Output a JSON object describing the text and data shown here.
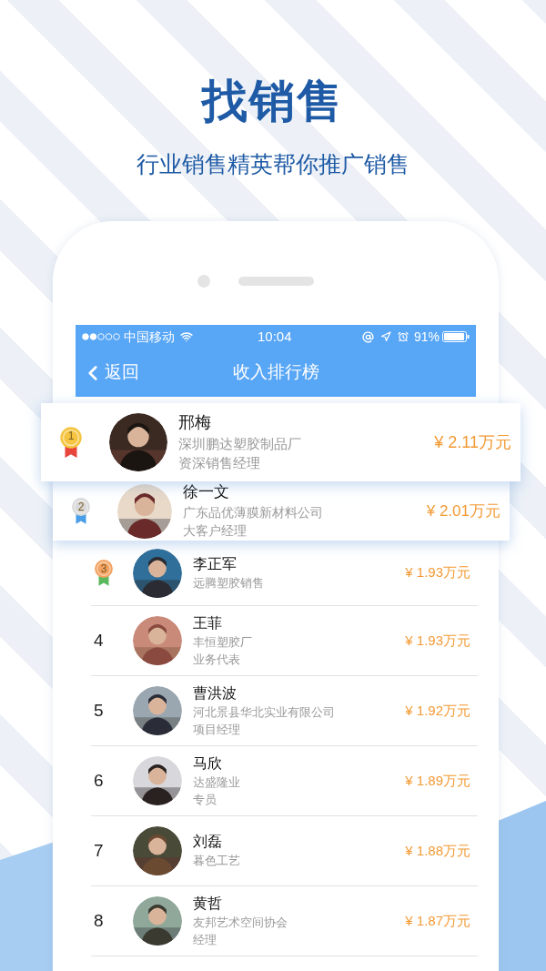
{
  "headline": "找销售",
  "subtitle": "行业销售精英帮你推广销售",
  "status_bar": {
    "carrier": "中国移动",
    "time": "10:04",
    "battery": "91%"
  },
  "nav_bar": {
    "back": "返回",
    "title": "收入排行榜"
  },
  "rows": [
    {
      "kind": "large",
      "medal": {
        "color": "#f5c542",
        "ribbon": {
          "color": "#e8453c"
        }
      },
      "rank": "1",
      "name": "邢梅",
      "company": "深圳鹏达塑胶制品厂",
      "title": "资深销售经理",
      "amount": "¥ 2.11万元"
    },
    {
      "kind": "medium",
      "medal": {
        "color": "#d9d9d9",
        "ribbon": {
          "color": "#4a9ee8"
        }
      },
      "rank": "2",
      "name": "徐一文",
      "company": "广东品优薄膜新材料公司",
      "title": "大客户经理",
      "amount": "¥ 2.01万元"
    },
    {
      "kind": "plain",
      "medal": {
        "color": "#f4a261",
        "ribbon": {
          "color": "#5cb85c"
        }
      },
      "rank": "3",
      "name": "李正军",
      "company": "远腾塑胶销售",
      "amount": "¥ 1.93万元"
    },
    {
      "kind": "plain",
      "rank": "4",
      "name": "王菲",
      "company": "丰恒塑胶厂",
      "title": "业务代表",
      "amount": "¥ 1.93万元"
    },
    {
      "kind": "plain",
      "rank": "5",
      "name": "曹洪波",
      "company": "河北景县华北实业有限公司",
      "title": "项目经理",
      "amount": "¥ 1.92万元"
    },
    {
      "kind": "plain",
      "rank": "6",
      "name": "马欣",
      "company": "达盛隆业",
      "title": "专员",
      "amount": "¥ 1.89万元"
    },
    {
      "kind": "plain",
      "rank": "7",
      "name": "刘磊",
      "company": "暮色工艺",
      "amount": "¥ 1.88万元"
    },
    {
      "kind": "plain",
      "rank": "8",
      "name": "黄哲",
      "company": "友邦艺术空间协会",
      "title": "经理",
      "amount": "¥ 1.87万元"
    }
  ]
}
